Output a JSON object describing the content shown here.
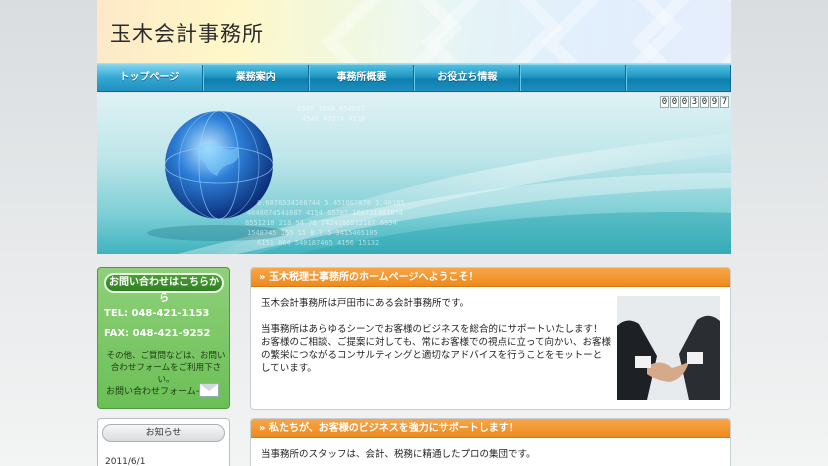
{
  "header": {
    "title": "玉木会計事務所"
  },
  "nav": {
    "items": [
      {
        "label": "トップページ"
      },
      {
        "label": "業務案内"
      },
      {
        "label": "事務所概要"
      },
      {
        "label": "お役立ち情報"
      },
      {
        "label": ""
      },
      {
        "label": ""
      }
    ]
  },
  "counter": {
    "digits": [
      "0",
      "0",
      "0",
      "3",
      "0",
      "9",
      "7"
    ]
  },
  "sidebar": {
    "contact_button": "お問い合わせはこちらから",
    "tel": "TEL: 048-421-1153",
    "fax": "FAX: 048-421-9252",
    "note": "その他、ご質問などは、お問い合わせフォームをご利用下さい。",
    "form_link": "お問い合わせフォーム→",
    "news_title": "お知らせ",
    "news_date": "2011/6/1"
  },
  "main": {
    "welcome_title": "玉木税理士事務所のホームページへようこそ！",
    "welcome_intro": "玉木会計事務所は戸田市にある会計事務所です。",
    "welcome_body": "当事務所はあらゆるシーンでお客様のビジネスを総合的にサポートいたします！お客様のご相談、ご提案に対しても、常にお客様での視点に立って向かい、お客様の繁栄につながるコンサルティングと適切なアドバイスを行うことをモットーとしています。",
    "support_title": "私たちが、お客様のビジネスを強力にサポートします！",
    "support_body": "当事務所のスタッフは、会計、税務に精通したプロの集団です。"
  },
  "colors": {
    "nav": "#1f97c4",
    "accent_orange": "#ee8a1d",
    "sidebar_green": "#6bbf56"
  }
}
